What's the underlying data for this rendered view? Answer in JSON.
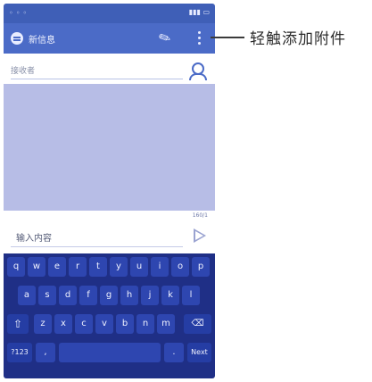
{
  "annotation": {
    "label": "轻触添加附件"
  },
  "phone": {
    "header": {
      "title": "新信息"
    },
    "recipient": {
      "placeholder": "接收者"
    },
    "compose": {
      "counter": "160/1",
      "placeholder": "输入内容"
    },
    "keyboard": {
      "row1": [
        "q",
        "w",
        "e",
        "r",
        "t",
        "y",
        "u",
        "i",
        "o",
        "p"
      ],
      "row2": [
        "a",
        "s",
        "d",
        "f",
        "g",
        "h",
        "j",
        "k",
        "l"
      ],
      "row3": [
        "z",
        "x",
        "c",
        "v",
        "b",
        "n",
        "m"
      ],
      "symbols_key": "?123",
      "comma_key": ",",
      "period_key": ".",
      "enter_key": "Next"
    }
  }
}
